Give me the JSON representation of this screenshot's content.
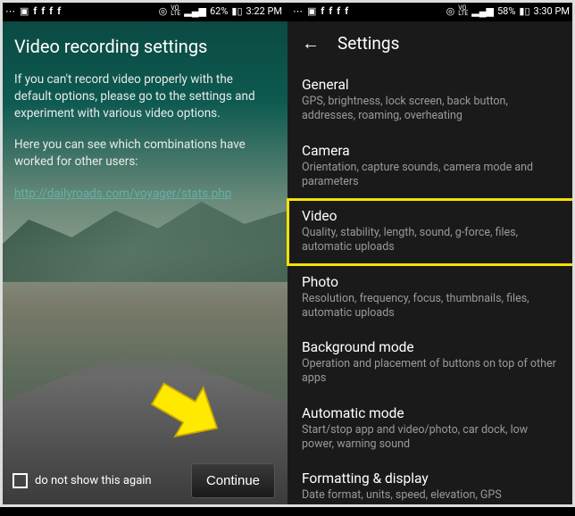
{
  "left": {
    "status": {
      "fb_icon": "f",
      "target_icon": "◎",
      "volte": "VO\nLTE",
      "signal": "▂▄▆",
      "battery_pct": "62%",
      "time": "3:22 PM"
    },
    "title": "Video recording settings",
    "para1": "If you can't record video properly with the default options, please go to the settings and experiment with various video options.",
    "para2": "Here you can see which combinations have worked for other users:",
    "link": "http://dailyroads.com/voyager/stats.php",
    "checkbox_label": "do not show this again",
    "continue_label": "Continue"
  },
  "right": {
    "status": {
      "battery_pct": "58%",
      "time": "3:30 PM"
    },
    "appbar_title": "Settings",
    "items": [
      {
        "title": "General",
        "sub": "GPS, brightness, lock screen, back button, addresses, roaming, overheating"
      },
      {
        "title": "Camera",
        "sub": "Orientation, capture sounds, camera mode and parameters"
      },
      {
        "title": "Video",
        "sub": "Quality, stability, length, sound, g-force, files, automatic uploads"
      },
      {
        "title": "Photo",
        "sub": "Resolution, frequency, focus, thumbnails, files, automatic uploads"
      },
      {
        "title": "Background mode",
        "sub": "Operation and placement of buttons on top of other apps"
      },
      {
        "title": "Automatic mode",
        "sub": "Start/stop app and video/photo, car dock, low power, warning sound"
      },
      {
        "title": "Formatting & display",
        "sub": "Date format, units, speed, elevation, GPS"
      }
    ]
  }
}
